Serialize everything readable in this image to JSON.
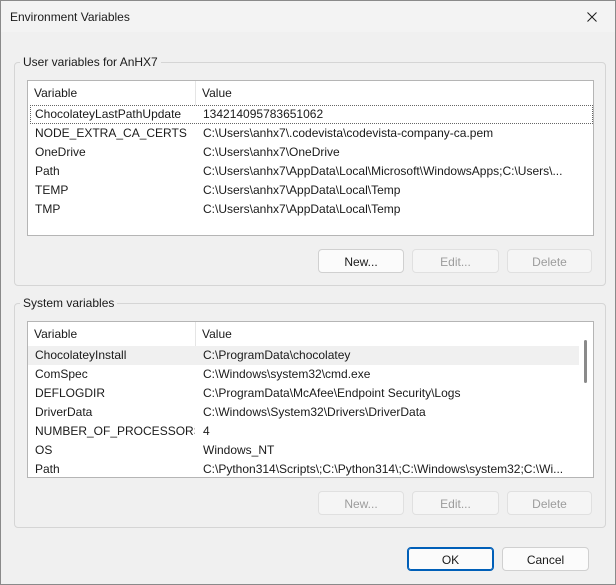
{
  "window": {
    "title": "Environment Variables"
  },
  "user_vars": {
    "group_label": "User variables for AnHX7",
    "columns": [
      "Variable",
      "Value"
    ],
    "rows": [
      {
        "name": "ChocolateyLastPathUpdate",
        "value": "134214095783651062"
      },
      {
        "name": "NODE_EXTRA_CA_CERTS",
        "value": "C:\\Users\\anhx7\\.codevista\\codevista-company-ca.pem"
      },
      {
        "name": "OneDrive",
        "value": "C:\\Users\\anhx7\\OneDrive"
      },
      {
        "name": "Path",
        "value": "C:\\Users\\anhx7\\AppData\\Local\\Microsoft\\WindowsApps;C:\\Users\\..."
      },
      {
        "name": "TEMP",
        "value": "C:\\Users\\anhx7\\AppData\\Local\\Temp"
      },
      {
        "name": "TMP",
        "value": "C:\\Users\\anhx7\\AppData\\Local\\Temp"
      }
    ],
    "buttons": {
      "new": "New...",
      "edit": "Edit...",
      "delete": "Delete"
    }
  },
  "system_vars": {
    "group_label": "System variables",
    "columns": [
      "Variable",
      "Value"
    ],
    "rows": [
      {
        "name": "ChocolateyInstall",
        "value": "C:\\ProgramData\\chocolatey"
      },
      {
        "name": "ComSpec",
        "value": "C:\\Windows\\system32\\cmd.exe"
      },
      {
        "name": "DEFLOGDIR",
        "value": "C:\\ProgramData\\McAfee\\Endpoint Security\\Logs"
      },
      {
        "name": "DriverData",
        "value": "C:\\Windows\\System32\\Drivers\\DriverData"
      },
      {
        "name": "NUMBER_OF_PROCESSORS",
        "value": "4"
      },
      {
        "name": "OS",
        "value": "Windows_NT"
      },
      {
        "name": "Path",
        "value": "C:\\Python314\\Scripts\\;C:\\Python314\\;C:\\Windows\\system32;C:\\Wi..."
      }
    ],
    "buttons": {
      "new": "New...",
      "edit": "Edit...",
      "delete": "Delete"
    }
  },
  "dialog_buttons": {
    "ok": "OK",
    "cancel": "Cancel"
  },
  "icons": {
    "close": "close-icon"
  },
  "colors": {
    "accent": "#005fb8",
    "selection": "#f0f0f0"
  }
}
